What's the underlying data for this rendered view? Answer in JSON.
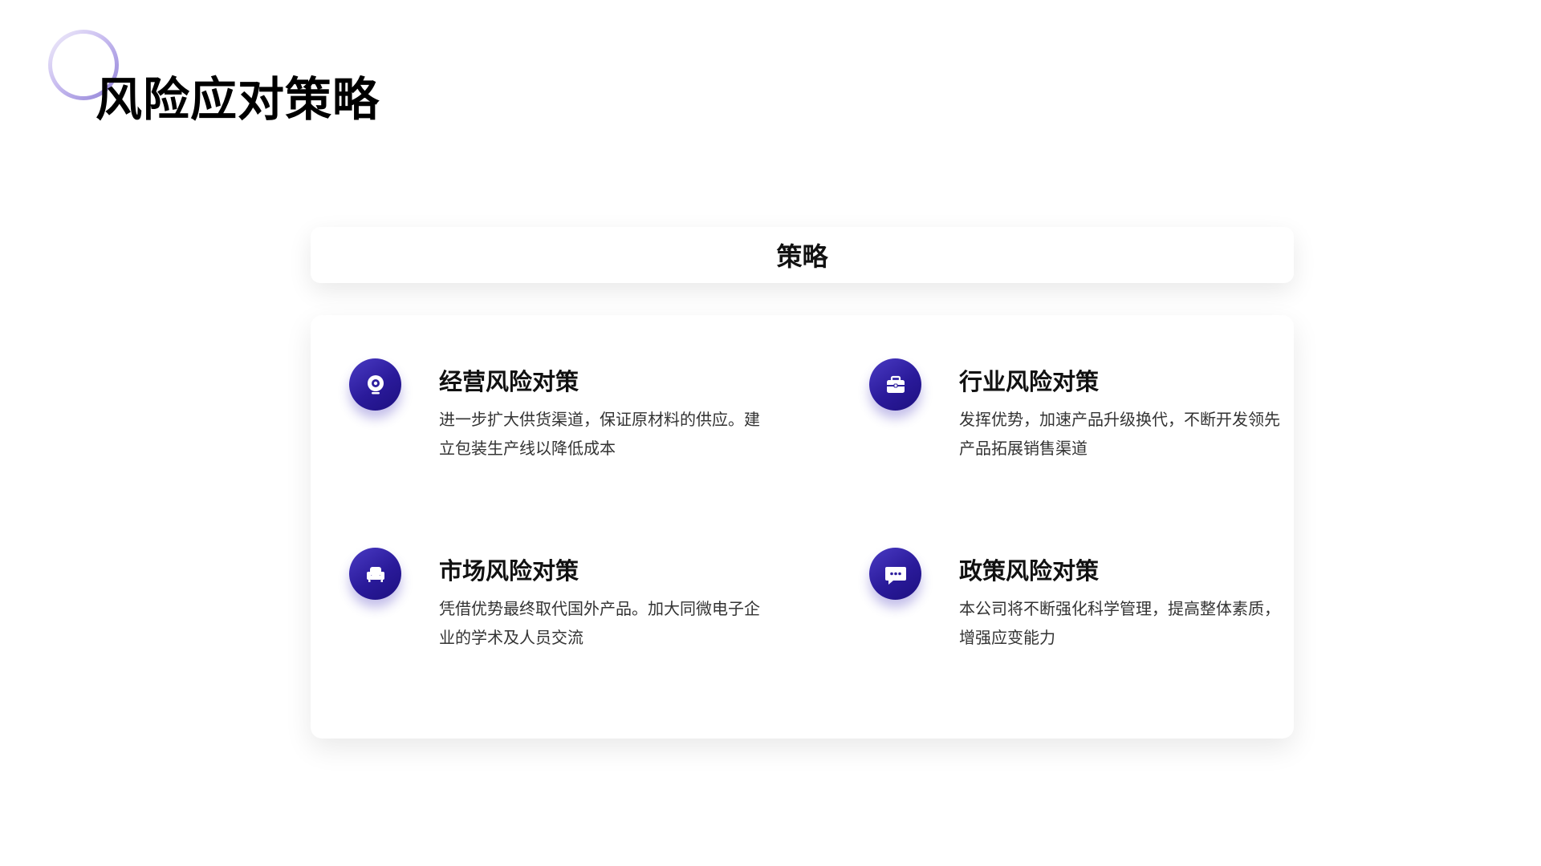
{
  "page": {
    "title": "风险应对策略"
  },
  "header_card": {
    "label": "策略"
  },
  "colors": {
    "icon_gradient_start": "#4a3bc4",
    "icon_gradient_end": "#1d1080",
    "ring_accent": "#8e7fd6"
  },
  "items": [
    {
      "icon": "webcam-icon",
      "title": "经营风险对策",
      "description": "进一步扩大供货渠道，保证原材料的供应。建立包装生产线以降低成本"
    },
    {
      "icon": "briefcase-icon",
      "title": "行业风险对策",
      "description": "发挥优势，加速产品升级换代，不断开发领先产品拓展销售渠道"
    },
    {
      "icon": "armchair-icon",
      "title": "市场风险对策",
      "description": "凭借优势最终取代国外产品。加大同微电子企业的学术及人员交流"
    },
    {
      "icon": "chat-bubble-icon",
      "title": "政策风险对策",
      "description": "本公司将不断强化科学管理，提高整体素质，增强应变能力"
    }
  ]
}
